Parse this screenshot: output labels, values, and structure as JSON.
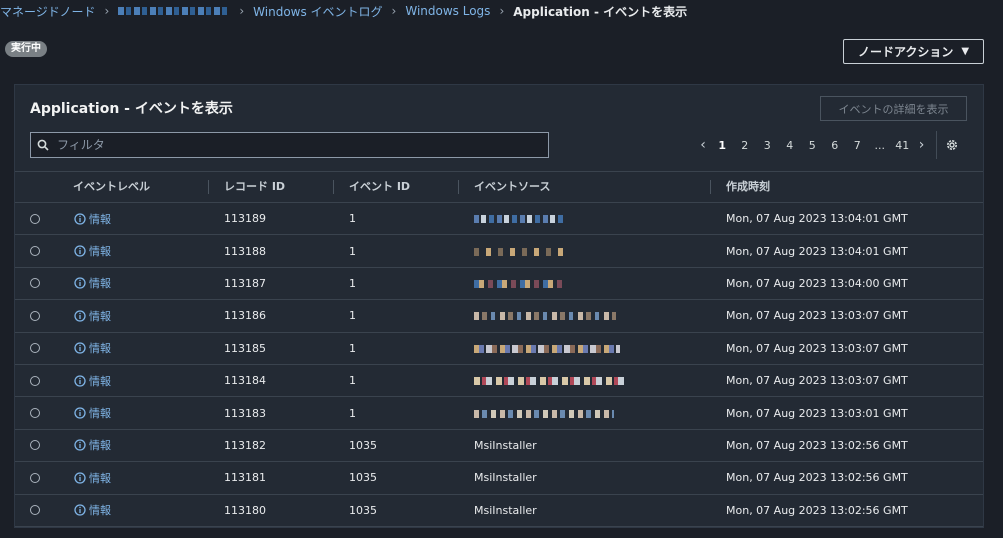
{
  "breadcrumb": {
    "items": [
      "マネージドノード",
      "Windows イベントログ",
      "Windows Logs"
    ],
    "current": "Application - イベントを表示"
  },
  "status": {
    "label": "実行中"
  },
  "node_action": {
    "label": "ノードアクション"
  },
  "panel": {
    "title": "Application - イベントを表示",
    "detail_button": "イベントの詳細を表示",
    "filter_placeholder": "フィルタ"
  },
  "pagination": {
    "pages": [
      "1",
      "2",
      "3",
      "4",
      "5",
      "6",
      "7",
      "...",
      "41"
    ],
    "active_page": "1"
  },
  "table": {
    "columns": [
      "イベントレベル",
      "レコード ID",
      "イベント ID",
      "イベントソース",
      "作成時刻"
    ],
    "rows": [
      {
        "level": "情報",
        "record_id": "113189",
        "event_id": "1",
        "source": "",
        "masked": "m1",
        "time": "Mon, 07 Aug 2023 13:04:01 GMT"
      },
      {
        "level": "情報",
        "record_id": "113188",
        "event_id": "1",
        "source": "",
        "masked": "m2",
        "time": "Mon, 07 Aug 2023 13:04:01 GMT"
      },
      {
        "level": "情報",
        "record_id": "113187",
        "event_id": "1",
        "source": "",
        "masked": "m3",
        "time": "Mon, 07 Aug 2023 13:04:00 GMT"
      },
      {
        "level": "情報",
        "record_id": "113186",
        "event_id": "1",
        "source": "",
        "masked": "m4",
        "time": "Mon, 07 Aug 2023 13:03:07 GMT"
      },
      {
        "level": "情報",
        "record_id": "113185",
        "event_id": "1",
        "source": "",
        "masked": "m5",
        "time": "Mon, 07 Aug 2023 13:03:07 GMT"
      },
      {
        "level": "情報",
        "record_id": "113184",
        "event_id": "1",
        "source": "",
        "masked": "m6",
        "time": "Mon, 07 Aug 2023 13:03:07 GMT"
      },
      {
        "level": "情報",
        "record_id": "113183",
        "event_id": "1",
        "source": "",
        "masked": "m7",
        "time": "Mon, 07 Aug 2023 13:03:01 GMT"
      },
      {
        "level": "情報",
        "record_id": "113182",
        "event_id": "1035",
        "source": "MsiInstaller",
        "masked": "",
        "time": "Mon, 07 Aug 2023 13:02:56 GMT"
      },
      {
        "level": "情報",
        "record_id": "113181",
        "event_id": "1035",
        "source": "MsiInstaller",
        "masked": "",
        "time": "Mon, 07 Aug 2023 13:02:56 GMT"
      },
      {
        "level": "情報",
        "record_id": "113180",
        "event_id": "1035",
        "source": "MsiInstaller",
        "masked": "",
        "time": "Mon, 07 Aug 2023 13:02:56 GMT"
      }
    ]
  },
  "colors": {
    "link": "#7fb4e6",
    "background": "#1b1f27",
    "panel": "#232a34"
  }
}
